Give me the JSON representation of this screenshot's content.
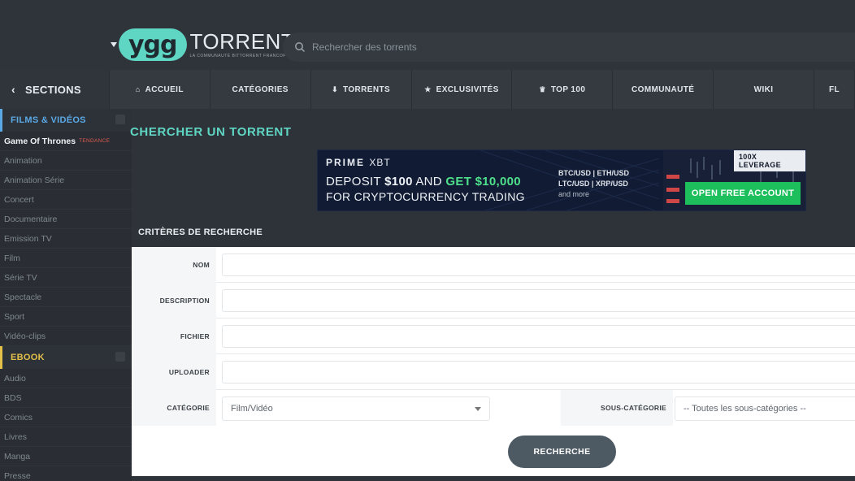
{
  "header": {
    "logo_mark": "ygg",
    "logo_text": "TORRENT",
    "logo_tagline": "LA COMMUNAUTÉ BITTORRENT FRANCOPHONE",
    "search_placeholder": "Rechercher des torrents"
  },
  "nav": {
    "sections_label": "SECTIONS",
    "items": [
      {
        "label": "ACCUEIL",
        "icon": "home-icon",
        "glyph": "⌂"
      },
      {
        "label": "CATÉGORIES",
        "icon": "",
        "glyph": ""
      },
      {
        "label": "TORRENTS",
        "icon": "download-icon",
        "glyph": "⬇"
      },
      {
        "label": "EXCLUSIVITÉS",
        "icon": "star-icon",
        "glyph": "★"
      },
      {
        "label": "TOP 100",
        "icon": "trophy-icon",
        "glyph": "♛"
      },
      {
        "label": "COMMUNAUTÉ",
        "icon": "",
        "glyph": ""
      },
      {
        "label": "WIKI",
        "icon": "",
        "glyph": ""
      },
      {
        "label": "FL",
        "icon": "",
        "glyph": ""
      }
    ]
  },
  "sidebar": {
    "films_head": "FILMS & VIDÉOS",
    "films_items": [
      "Game Of Thrones",
      "Animation",
      "Animation Série",
      "Concert",
      "Documentaire",
      "Emission TV",
      "Film",
      "Série TV",
      "Spectacle",
      "Sport",
      "Vidéo-clips"
    ],
    "tendance_label": "TENDANCE",
    "ebook_head": "EBOOK",
    "ebook_items": [
      "Audio",
      "BDS",
      "Comics",
      "Livres",
      "Manga",
      "Presse"
    ]
  },
  "main": {
    "title": "CHERCHER UN TORRENT",
    "criteria_title": "CRITÈRES DE RECHERCHE",
    "labels": {
      "name": "NOM",
      "description": "DESCRIPTION",
      "file": "FICHIER",
      "uploader": "UPLOADER",
      "category": "CATÉGORIE",
      "subcategory": "SOUS-CATÉGORIE"
    },
    "category_value": "Film/Vidéo",
    "subcategory_value": "-- Toutes les sous-catégories --",
    "search_button": "RECHERCHE"
  },
  "ad": {
    "brand_bold": "PRIME",
    "brand_thin": "XBT",
    "line1_a": "DEPOSIT ",
    "line1_b": "$100",
    "line1_c": " AND ",
    "line1_d": "GET $10,000",
    "line2": "FOR CRYPTOCURRENCY TRADING",
    "pairs1": "BTC/USD | ETH/USD",
    "pairs2": "LTC/USD | XRP/USD",
    "pairs3": "and more",
    "leverage": "100X LEVERAGE",
    "cta": "OPEN FREE ACCOUNT"
  },
  "colors": {
    "accent": "#5fd6c3",
    "films": "#5aa9e6",
    "ebook": "#e3c04a",
    "tendance": "#e05a4e",
    "ad_green": "#1dbf5c"
  }
}
